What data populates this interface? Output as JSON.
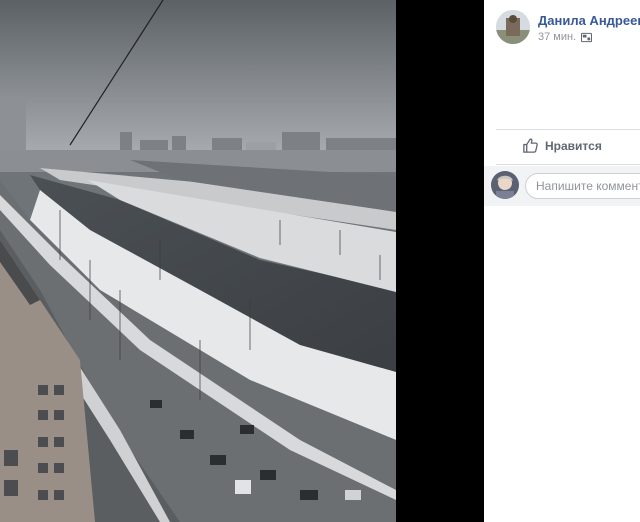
{
  "photo": {
    "description_icon": "city-river-photo"
  },
  "post": {
    "author": "Данила Андреев",
    "time": "37 мин.",
    "audience_icon": "photo-album-icon"
  },
  "actions": {
    "like_label": "Нравится"
  },
  "comment": {
    "placeholder": "Напишите комментарий..."
  },
  "colors": {
    "author_link": "#385898",
    "muted_text": "#90949c",
    "action_text": "#606770"
  }
}
